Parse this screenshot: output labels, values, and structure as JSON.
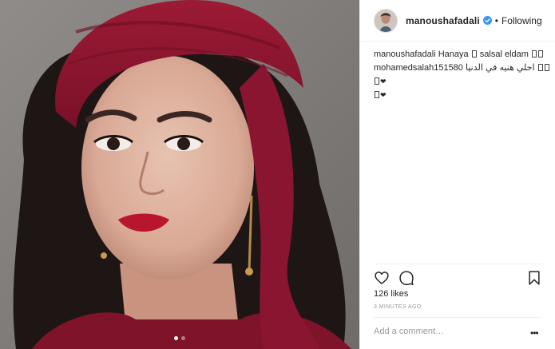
{
  "post": {
    "username": "manoushafadali",
    "separator": "•",
    "follow_status": "Following",
    "carousel": {
      "count": 2,
      "active": 1
    }
  },
  "comments": [
    {
      "user": "manoushafadali",
      "text_before": "Hanaya",
      "text_mid": "salsal eldam",
      "boxes": [
        1,
        2
      ]
    },
    {
      "user": "mohamedsalah151580",
      "text": "احلي هنيه في الدنيا"
    }
  ],
  "actions": {
    "icons": [
      "heart-icon",
      "comment-icon",
      "bookmark-icon"
    ]
  },
  "likes": "126 likes",
  "timestamp": "3 MINUTES AGO",
  "add_comment": {
    "placeholder": "Add a comment…",
    "more": "•••"
  },
  "colors": {
    "accent_verified": "#3897f0",
    "scarf": "#8e1630",
    "text": "#262626",
    "muted": "#999999"
  }
}
